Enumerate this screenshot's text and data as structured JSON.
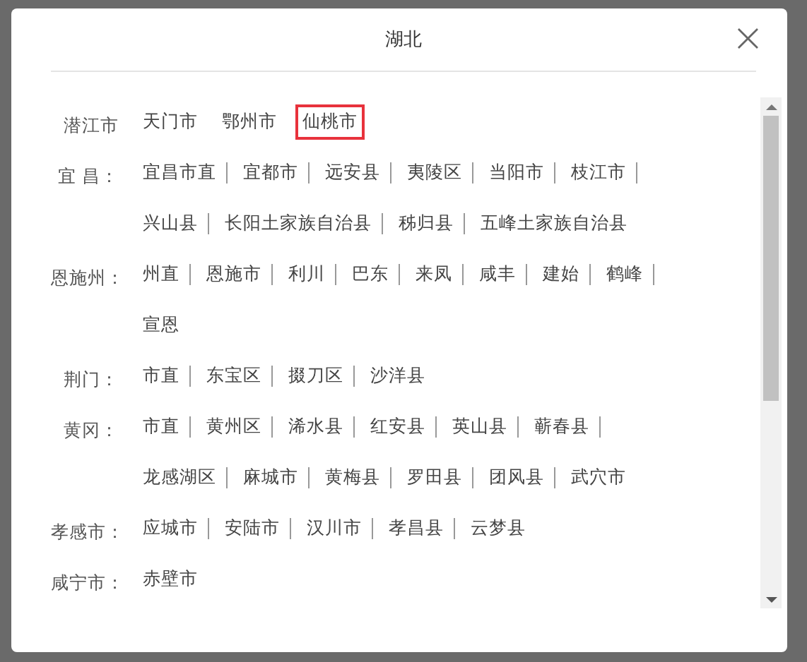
{
  "dialog": {
    "title": "湖北",
    "close_label": "×"
  },
  "groups": [
    {
      "label": "潜江市",
      "kind": "plain",
      "lines": [
        [
          {
            "name": "天门市",
            "selected": false
          },
          {
            "name": "鄂州市",
            "selected": false
          },
          {
            "name": "仙桃市",
            "selected": true
          }
        ]
      ]
    },
    {
      "label": "宜 昌：",
      "kind": "separated",
      "lines": [
        [
          {
            "name": "宜昌市直",
            "selected": false
          },
          {
            "name": "宜都市",
            "selected": false
          },
          {
            "name": "远安县",
            "selected": false
          },
          {
            "name": "夷陵区",
            "selected": false
          },
          {
            "name": "当阳市",
            "selected": false
          },
          {
            "name": "枝江市",
            "selected": false
          }
        ],
        [
          {
            "name": "兴山县",
            "selected": false
          },
          {
            "name": "长阳土家族自治县",
            "selected": false
          },
          {
            "name": "秭归县",
            "selected": false
          },
          {
            "name": "五峰土家族自治县",
            "selected": false
          }
        ]
      ]
    },
    {
      "label": "恩施州：",
      "kind": "separated",
      "lines": [
        [
          {
            "name": "州直",
            "selected": false
          },
          {
            "name": "恩施市",
            "selected": false
          },
          {
            "name": "利川",
            "selected": false
          },
          {
            "name": "巴东",
            "selected": false
          },
          {
            "name": "来凤",
            "selected": false
          },
          {
            "name": "咸丰",
            "selected": false
          },
          {
            "name": "建始",
            "selected": false
          },
          {
            "name": "鹤峰",
            "selected": false
          }
        ],
        [
          {
            "name": "宣恩",
            "selected": false
          }
        ]
      ]
    },
    {
      "label": "荆门：",
      "kind": "separated",
      "lines": [
        [
          {
            "name": "市直",
            "selected": false
          },
          {
            "name": "东宝区",
            "selected": false
          },
          {
            "name": "掇刀区",
            "selected": false
          },
          {
            "name": "沙洋县",
            "selected": false
          }
        ]
      ]
    },
    {
      "label": "黄冈：",
      "kind": "separated",
      "lines": [
        [
          {
            "name": "市直",
            "selected": false
          },
          {
            "name": "黄州区",
            "selected": false
          },
          {
            "name": "浠水县",
            "selected": false
          },
          {
            "name": "红安县",
            "selected": false
          },
          {
            "name": "英山县",
            "selected": false
          },
          {
            "name": "蕲春县",
            "selected": false
          }
        ],
        [
          {
            "name": "龙感湖区",
            "selected": false
          },
          {
            "name": "麻城市",
            "selected": false
          },
          {
            "name": "黄梅县",
            "selected": false
          },
          {
            "name": "罗田县",
            "selected": false
          },
          {
            "name": "团风县",
            "selected": false
          },
          {
            "name": "武穴市",
            "selected": false
          }
        ]
      ]
    },
    {
      "label": "孝感市：",
      "kind": "separated",
      "lines": [
        [
          {
            "name": "应城市",
            "selected": false
          },
          {
            "name": "安陆市",
            "selected": false
          },
          {
            "name": "汉川市",
            "selected": false
          },
          {
            "name": "孝昌县",
            "selected": false
          },
          {
            "name": "云梦县",
            "selected": false
          }
        ]
      ]
    },
    {
      "label": "咸宁市：",
      "kind": "separated",
      "lines": [
        [
          {
            "name": "赤壁市",
            "selected": false
          }
        ]
      ]
    }
  ]
}
